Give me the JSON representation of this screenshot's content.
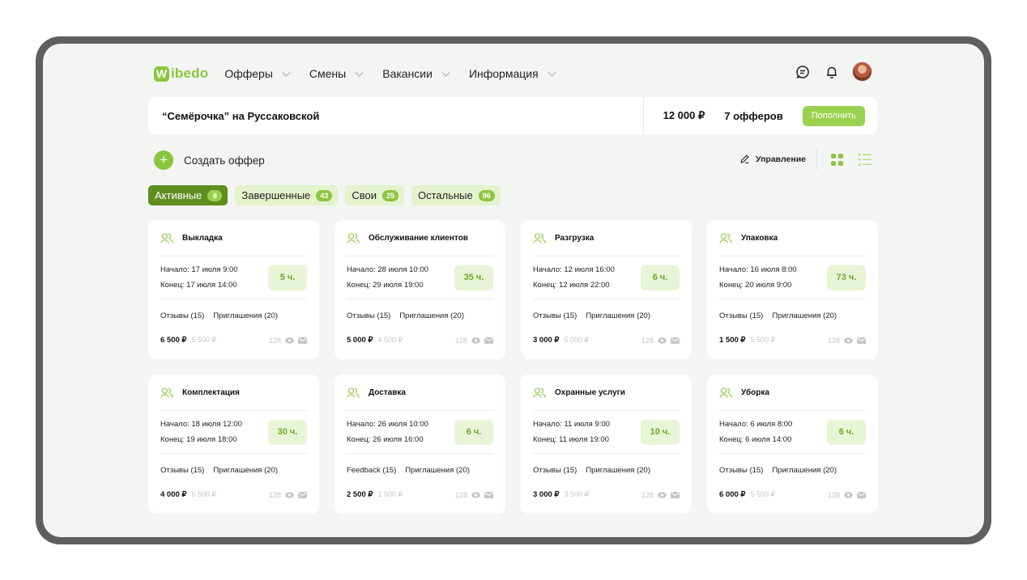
{
  "colors": {
    "accent": "#8cc63f",
    "accent_dark": "#5e8f1e",
    "accent_light": "#e4f2cd",
    "frame": "#5f5f5f",
    "background": "#f3f5f3"
  },
  "brand": {
    "logo_letter": "W",
    "logo_text": "ibedo"
  },
  "nav": {
    "items": [
      {
        "label": "Офферы"
      },
      {
        "label": "Смены"
      },
      {
        "label": "Вакансии"
      },
      {
        "label": "Информация"
      }
    ]
  },
  "store": {
    "name": "“Семёрочка” на Руссаковской",
    "balance": "12 000 ₽",
    "offers_count": "7 офферов",
    "topup_label": "Пополнить"
  },
  "actions": {
    "create_icon": "+",
    "create_label": "Создать оффер",
    "manage_label": "Управление"
  },
  "tabs": [
    {
      "label": "Активные",
      "count": "6",
      "active": true
    },
    {
      "label": "Завершенные",
      "count": "43",
      "active": false
    },
    {
      "label": "Свои",
      "count": "25",
      "active": false
    },
    {
      "label": "Остальные",
      "count": "96",
      "active": false
    }
  ],
  "cards": [
    {
      "title": "Выкладка",
      "start": "Начало: 17 июля 9:00",
      "end": "Конец: 17 июля 14:00",
      "hours": "5 ч.",
      "reviews": "Отзывы (15)",
      "invites": "Приглашения (20)",
      "price": "6 500 ₽",
      "old_price": "5 500 ₽",
      "views": "128"
    },
    {
      "title": "Обслуживание клиентов",
      "start": "Начало: 28 июля 10:00",
      "end": "Конец: 29 июля 19:00",
      "hours": "35 ч.",
      "reviews": "Отзывы (15)",
      "invites": "Приглашения (20)",
      "price": "5 000 ₽",
      "old_price": "4 500 ₽",
      "views": "128"
    },
    {
      "title": "Разгрузка",
      "start": "Начало: 12 июля 16:00",
      "end": "Конец: 12 июля 22:00",
      "hours": "6 ч.",
      "reviews": "Отзывы (15)",
      "invites": "Приглашения (20)",
      "price": "3 000 ₽",
      "old_price": "5 000 ₽",
      "views": "128"
    },
    {
      "title": "Упаковка",
      "start": "Начало: 16 июля 8:00",
      "end": "Конец: 20 июля 9:00",
      "hours": "73 ч.",
      "reviews": "Отзывы (15)",
      "invites": "Приглашения (20)",
      "price": "1 500 ₽",
      "old_price": "5 500 ₽",
      "views": "128"
    },
    {
      "title": "Комплектация",
      "start": "Начало: 18 июля 12:00",
      "end": "Конец: 19 июля 18:00",
      "hours": "30 ч.",
      "reviews": "Отзывы (15)",
      "invites": "Приглашения (20)",
      "price": "4 000 ₽",
      "old_price": "6 500 ₽",
      "views": "128"
    },
    {
      "title": "Доставка",
      "start": "Начало: 26 июля 10:00",
      "end": "Конец: 26 июля 16:00",
      "hours": "6 ч.",
      "reviews": "Feedback (15)",
      "invites": "Приглашения (20)",
      "price": "2 500 ₽",
      "old_price": "1 500 ₽",
      "views": "128"
    },
    {
      "title": "Охранные услуги",
      "start": "Начало: 11 июля 9:00",
      "end": "Конец: 11 июля 19:00",
      "hours": "10 ч.",
      "reviews": "Отзывы (15)",
      "invites": "Приглашения (20)",
      "price": "3 000 ₽",
      "old_price": "3 500 ₽",
      "views": "128"
    },
    {
      "title": "Уборка",
      "start": "Начало: 6 июля 8:00",
      "end": "Конец: 6 июля 14:00",
      "hours": "6 ч.",
      "reviews": "Отзывы (15)",
      "invites": "Приглашения (20)",
      "price": "6 000 ₽",
      "old_price": "5 500 ₽",
      "views": "128"
    }
  ]
}
